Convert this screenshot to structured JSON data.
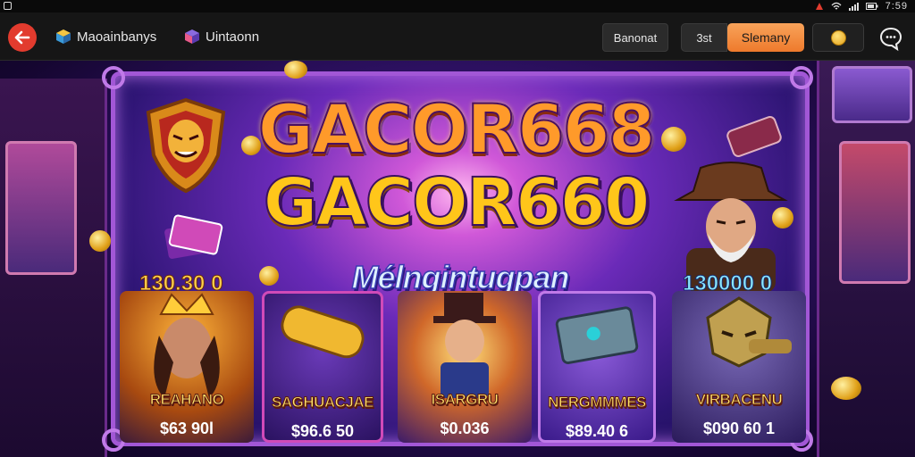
{
  "status_bar": {
    "time": "7:59"
  },
  "topbar": {
    "tab1_label": "Maoainbanys",
    "tab2_label": "Uintaonn",
    "button1_label": "Banonat",
    "button2_label": "3st",
    "button3_label": "Slemany"
  },
  "game": {
    "logo_line1": "GACOR668",
    "logo_line2": "GACOR660",
    "tagline": "Mélngintugpan",
    "left_stat": "130.30 0",
    "right_stat": "130000 0",
    "cards": [
      {
        "name": "REAHANO",
        "price": "$63 90l"
      },
      {
        "name": "SAGHUACJAE",
        "price": "$96.6 50"
      },
      {
        "name": "ISARGRU",
        "price": "$0.036"
      },
      {
        "name": "NERGMMMES",
        "price": "$89.40   6"
      },
      {
        "name": "VIRBACENU",
        "price": "$090 60 1"
      }
    ]
  },
  "colors": {
    "accent_orange": "#ee7a2c",
    "back_red": "#e23b2e",
    "frame_purple": "#a257d6"
  }
}
